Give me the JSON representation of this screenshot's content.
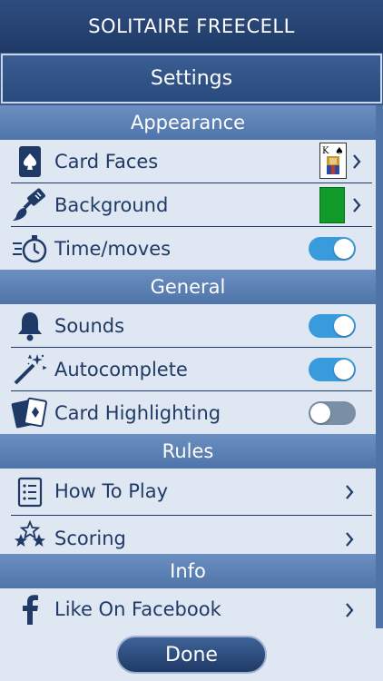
{
  "app": {
    "title": "SOLITAIRE FREECELL"
  },
  "page": {
    "title": "Settings"
  },
  "sections": {
    "appearance": {
      "title": "Appearance",
      "items": [
        {
          "label": "Card Faces",
          "icon": "spade-card-icon",
          "control": "chevron",
          "preview": "king-of-spades-card"
        },
        {
          "label": "Background",
          "icon": "paintbrush-icon",
          "control": "chevron",
          "preview_color": "#0f9a2a"
        },
        {
          "label": "Time/moves",
          "icon": "stopwatch-icon",
          "control": "toggle",
          "on": true
        }
      ]
    },
    "general": {
      "title": "General",
      "items": [
        {
          "label": "Sounds",
          "icon": "bell-icon",
          "control": "toggle",
          "on": true
        },
        {
          "label": "Autocomplete",
          "icon": "magic-wand-icon",
          "control": "toggle",
          "on": true
        },
        {
          "label": "Card Highlighting",
          "icon": "cards-icon",
          "control": "toggle",
          "on": false
        }
      ]
    },
    "rules": {
      "title": "Rules",
      "items": [
        {
          "label": "How To Play",
          "icon": "list-icon",
          "control": "chevron"
        },
        {
          "label": "Scoring",
          "icon": "stars-icon",
          "control": "chevron"
        }
      ]
    },
    "info": {
      "title": "Info",
      "items": [
        {
          "label": "Like On Facebook",
          "icon": "facebook-icon",
          "control": "chevron"
        }
      ]
    }
  },
  "card_preview": {
    "rank": "K",
    "suit": "♠"
  },
  "footer": {
    "done_label": "Done"
  },
  "colors": {
    "header": "#1f3a66",
    "section": "#5a7fb4",
    "list_bg": "#dfe7f3",
    "text": "#1f3a66",
    "toggle_on": "#3a9bdc",
    "toggle_off": "#7a8ea6",
    "background_swatch": "#0f9a2a"
  }
}
